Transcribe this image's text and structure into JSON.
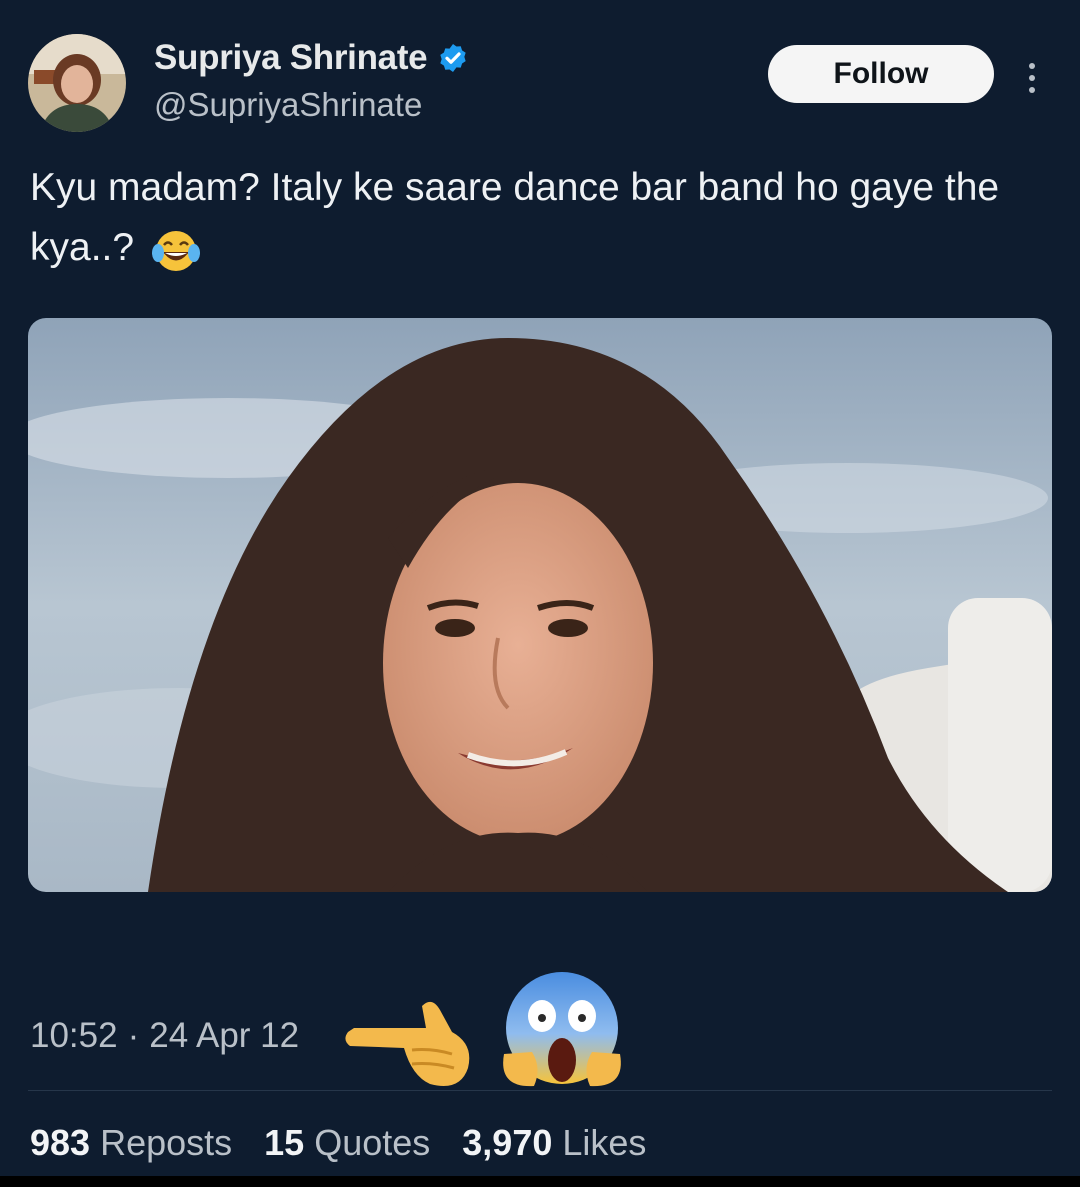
{
  "author": {
    "name": "Supriya Shrinate",
    "handle": "@SupriyaShrinate",
    "verified": true
  },
  "follow_label": "Follow",
  "tweet": {
    "text": "Kyu madam? Italy ke saare dance bar band ho gaye the kya..?",
    "emoji": "face-with-tears-of-joy-icon"
  },
  "meta": {
    "time": "10:52",
    "date": "24 Apr 12"
  },
  "stats": {
    "reposts_count": "983",
    "reposts_label": "Reposts",
    "quotes_count": "15",
    "quotes_label": "Quotes",
    "likes_count": "3,970",
    "likes_label": "Likes"
  },
  "colors": {
    "background": "#0e1c2f",
    "verified": "#1d9bf0",
    "follow_button": "#f5f5f5"
  }
}
